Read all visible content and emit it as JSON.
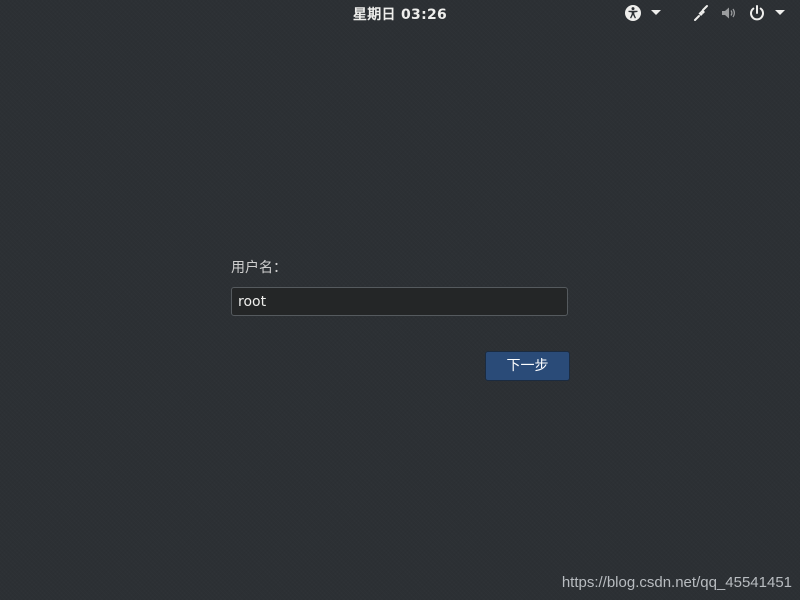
{
  "topbar": {
    "clock": "星期日 03:26",
    "icons": [
      "accessibility-icon",
      "network-icon",
      "volume-icon",
      "power-icon"
    ]
  },
  "login": {
    "username_label": "用户名：",
    "username_value": "root",
    "next_button_label": "下一步"
  },
  "watermark": "https://blog.csdn.net/qq_45541451",
  "colors": {
    "background": "#2c3034",
    "button": "#2a4b78",
    "field": "#242627"
  }
}
